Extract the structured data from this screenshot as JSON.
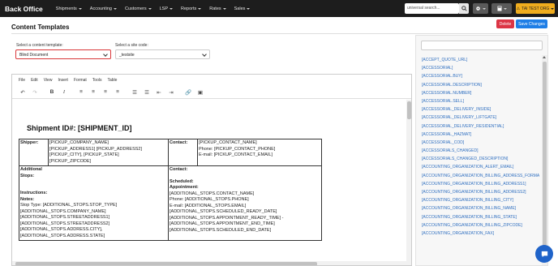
{
  "nav": {
    "brand": "Back Office",
    "items": [
      "Shipments",
      "Accounting",
      "Customers",
      "LSP",
      "Reports",
      "Rates",
      "Sales"
    ],
    "search_placeholder": "universal search...",
    "org_label": "TAI TEST ORG"
  },
  "page": {
    "title": "Content Templates",
    "delete_label": "Delete",
    "save_label": "Save Changes"
  },
  "selectors": {
    "template_label": "Select a content template:",
    "template_value": "Blind Document",
    "site_label": "Select a site code:",
    "site_value": "_testsite"
  },
  "editor": {
    "menus": [
      "File",
      "Edit",
      "View",
      "Insert",
      "Format",
      "Tools",
      "Table"
    ],
    "toolbar_icons": [
      "undo-icon",
      "redo-icon",
      "bold-icon",
      "italic-icon",
      "align-left-icon",
      "align-center-icon",
      "align-right-icon",
      "align-justify-icon",
      "bullet-list-icon",
      "numbered-list-icon",
      "outdent-icon",
      "indent-icon",
      "link-icon",
      "image-icon"
    ],
    "doc_title": "Shipment ID#: [SHIPMENT_ID]",
    "shipper_label": "Shipper:",
    "shipper_lines": [
      "[PICKUP_COMPANY_NAME]",
      "[PICKUP_ADDRESS1] [PICKUP_ADDRESS2]",
      "[PICKUP_CITY], [PICKUP_STATE]",
      "[PICKUP_ZIPCODE]"
    ],
    "contact_label": "Contact:",
    "contact_lines": [
      "[PICKUP_CONTACT_NAME]",
      "Phone: [PICKUP_CONTACT_PHONE]",
      "E-mail: [PICKUP_CONTACT_EMAIL]"
    ],
    "additional_stops_label": "Additional Stops:",
    "stops_contact_label": "Contact:",
    "scheduled_label": "Scheduled: Appointment:",
    "instructions_label": "Instructions:",
    "notes_label": "Notes:",
    "stops_left_lines": [
      "Stop Type: [ADDITIONAL_STOPS.STOP_TYPE]",
      "[ADDITIONAL_STOPS.COMPANY_NAME]",
      "[ADDITIONAL_STOPS.STREETADDRESS1]",
      "[ADDITIONAL_STOPS.STREETADDRESS2]",
      "[ADDITIONAL_STOPS.ADDRESS.CITY],",
      "[ADDITIONAL_STOPS.ADDRESS.STATE]"
    ],
    "stops_right_lines": [
      "[ADDITIONAL_STOPS.CONTACT_NAME]",
      "Phone: [ADDITIONAL_STOPS.PHONE]",
      "E-mail: [ADDITIONAL_STOPS.EMAIL]",
      "[ADDITIONAL_STOPS.SCHEDULED_READY_DATE]",
      "[ADDITIONAL_STOPS.APPOINTMENT_READY_TIME] -",
      "[ADDITIONAL_STOPS.APPOINTMENT_END_TIME]",
      "[ADDITIONAL_STOPS.SCHEDULED_END_DATE]"
    ]
  },
  "tokens": [
    "[ACCEPT_QUOTE_URL]",
    "[ACCESSORIAL]",
    "[ACCESSORIAL.BUY]",
    "[ACCESSORIAL.DESCRIPTION]",
    "[ACCESSORIAL.NUMBER]",
    "[ACCESSORIAL.SELL]",
    "[ACCESSORIAL_DELIVERY_INSIDE]",
    "[ACCESSORIAL_DELIVERY_LIFTGATE]",
    "[ACCESSORIAL_DELIVERY_RESIDENTIAL]",
    "[ACCESSORIAL_HAZMAT]",
    "[ACCESSORIAL_COD]",
    "[ACCESSORIALS_CHANGED]",
    "[ACCESSORIALS_CHANGED_DESCRIPTION]",
    "[ACCOUNTING_ORGANIZATION_ALERT_EMAIL]",
    "[ACCOUNTING_ORGANIZATION_BILLING_ADDRESS_FORMATTED]",
    "[ACCOUNTING_ORGANIZATION_BILLING_ADDRESS1]",
    "[ACCOUNTING_ORGANIZATION_BILLING_ADDRESS2]",
    "[ACCOUNTING_ORGANIZATION_BILLING_CITY]",
    "[ACCOUNTING_ORGANIZATION_BILLING_NAME]",
    "[ACCOUNTING_ORGANIZATION_BILLING_STATE]",
    "[ACCOUNTING_ORGANIZATION_BILLING_ZIPCODE]",
    "[ACCOUNTING_ORGANIZATION_FAX]"
  ]
}
